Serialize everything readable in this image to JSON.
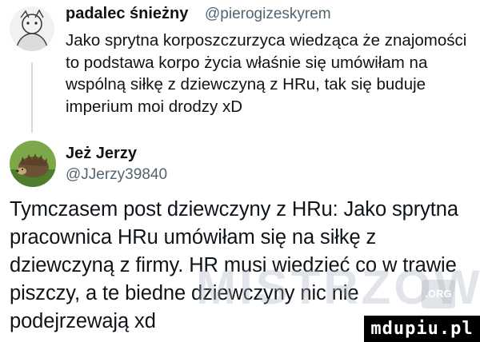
{
  "reply": {
    "author_name": "padalec śnieżny",
    "author_handle": "@pierogizeskyrem",
    "text": "Jako sprytna korposzczurzyca wiedząca że znajomości to podstawa korpo życia właśnie się umówiłam na wspólną siłkę z dziewczyną z HRu, tak się buduje imperium moi drodzy xD"
  },
  "post": {
    "author_name": "Jeż Jerzy",
    "author_handle": "@JJerzy39840",
    "text": "Tymczasem post dziewczyny z HRu: Jako sprytna pracownica HRu umówiłam się na siłkę z dziewczyną z firmy. HR musi wiedzieć co w trawie piszczy, a te biedne dziewczyny nic nie podejrzewają xd"
  },
  "watermark": {
    "text": "MISTRZOWIE",
    "tld": ".ORG"
  },
  "corner_badge": {
    "text": "mdupiu.pl"
  }
}
